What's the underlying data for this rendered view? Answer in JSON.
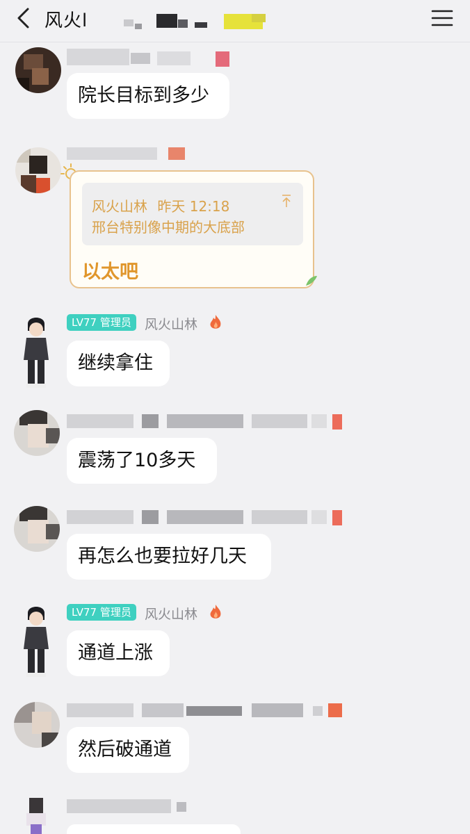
{
  "header": {
    "title": "风火l",
    "back_icon": "chevron-left-icon",
    "menu_icon": "hamburger-menu-icon"
  },
  "messages": [
    {
      "text": "院长目标到多少"
    },
    {
      "quote_sender": "风火山林",
      "quote_time": "昨天 12:18",
      "quote_text": "邢台特别像中期的大底部",
      "reply_text": "以太吧"
    },
    {
      "badge": "LV77 管理员",
      "sender": "风火山林",
      "text": "继续拿住"
    },
    {
      "text": "震荡了10多天"
    },
    {
      "text": "再怎么也要拉好几天"
    },
    {
      "badge": "LV77 管理员",
      "sender": "风火山林",
      "text": "通道上涨"
    },
    {
      "text": "然后破通道"
    }
  ],
  "colors": {
    "background": "#f1f1f3",
    "badge": "#3fd0c0",
    "quote_text": "#d9a24b",
    "reply_text": "#e0962c",
    "card_border": "#e8c28d"
  }
}
